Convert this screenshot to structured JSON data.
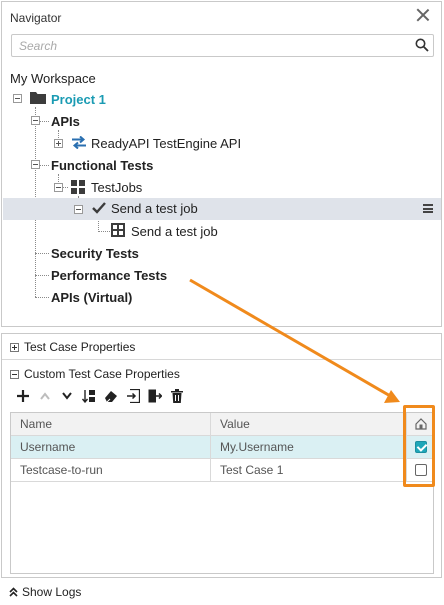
{
  "navigator": {
    "title": "Navigator",
    "search_placeholder": "Search",
    "workspace": "My Workspace",
    "tree": {
      "project": "Project 1",
      "apis": "APIs",
      "api_item": "ReadyAPI TestEngine API",
      "functional_tests": "Functional Tests",
      "testjobs": "TestJobs",
      "send_job_selected": "Send a test job",
      "send_job_child": "Send a test job",
      "security_tests": "Security Tests",
      "performance_tests": "Performance Tests",
      "apis_virtual": "APIs (Virtual)"
    }
  },
  "properties": {
    "test_case_props_label": "Test Case Properties",
    "custom_props_label": "Custom Test Case Properties",
    "columns": {
      "name": "Name",
      "value": "Value"
    },
    "rows": [
      {
        "name": "Username",
        "value": "My.Username",
        "checked": true
      },
      {
        "name": "Testcase-to-run",
        "value": "Test Case 1",
        "checked": false
      }
    ]
  },
  "footer": {
    "show_logs": "Show Logs"
  },
  "colors": {
    "accent": "#1a9bb3",
    "highlight": "#f08a1c",
    "selection": "#dfe3ea",
    "row_selection": "#daf0f3"
  }
}
